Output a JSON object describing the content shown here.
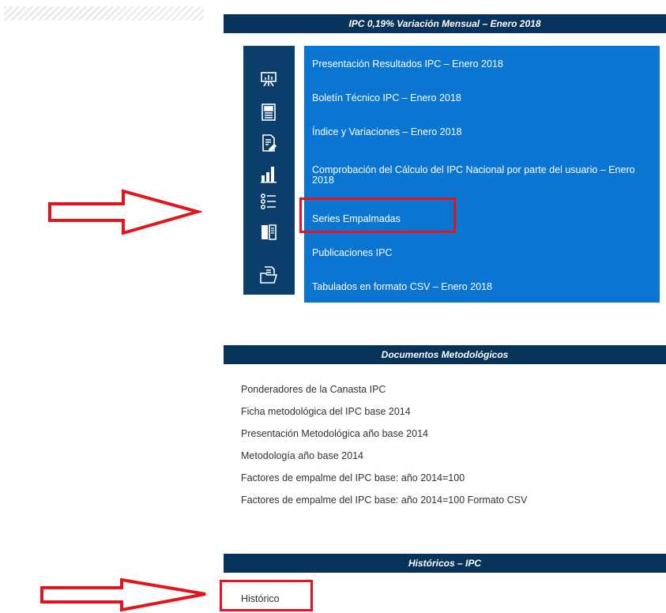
{
  "section_ipc": {
    "title": "IPC 0,19% Variación Mensual – Enero 2018",
    "icons": [
      "presentation-board-icon",
      "newspaper-icon",
      "document-edit-icon",
      "bar-chart-icon",
      "checklist-icon",
      "book-icon",
      "folder-files-icon"
    ],
    "links": [
      "Presentación Resultados IPC – Enero 2018",
      "Boletín Técnico IPC – Enero 2018",
      "Índice y Variaciones – Enero 2018",
      "Comprobación del Cálculo del IPC Nacional por parte del usuario – Enero 2018",
      "Series Empalmadas",
      "Publicaciones IPC",
      "Tabulados en formato CSV – Enero 2018"
    ]
  },
  "section_docs": {
    "title": "Documentos Metodológicos",
    "items": [
      "Ponderadores de la Canasta IPC",
      "Ficha metodológica del IPC base 2014",
      "Presentación Metodológica año base 2014",
      "Metodología año base 2014",
      "Factores de empalme del IPC base: año 2014=100",
      "Factores de empalme del IPC base: año 2014=100 Formato CSV"
    ]
  },
  "section_historicos": {
    "title": "Históricos – IPC",
    "items": [
      "Histórico"
    ]
  },
  "colors": {
    "header": "#07335a",
    "icon_column": "#0c3e6c",
    "link_panel": "#0a76d1",
    "annotation_red": "#e3141b"
  }
}
